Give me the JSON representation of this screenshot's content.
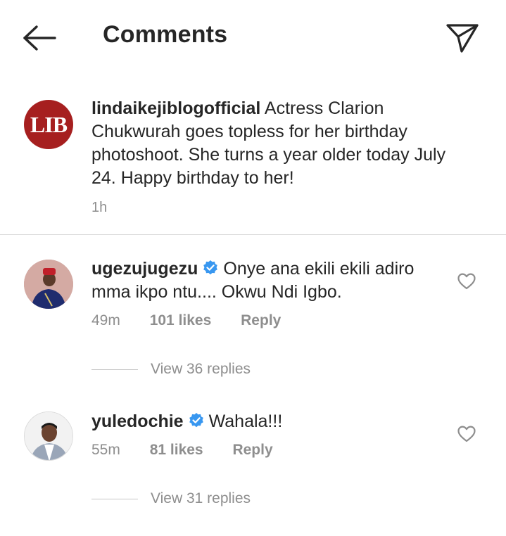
{
  "header": {
    "title": "Comments",
    "back_icon": "arrow-left-icon",
    "send_icon": "paper-plane-icon"
  },
  "caption": {
    "avatar_text": "LIB",
    "username": "lindaikejiblogofficial",
    "text": "Actress Clarion Chukwurah goes topless for her birthday photoshoot. She turns a year older today July 24. Happy birthday to her!",
    "time": "1h"
  },
  "comments": [
    {
      "username": "ugezujugezu",
      "verified": true,
      "text": "Onye ana ekili ekili adiro mma ikpo ntu.... Okwu Ndi Igbo.",
      "time": "49m",
      "likes": "101 likes",
      "reply": "Reply",
      "view_replies": "View 36 replies"
    },
    {
      "username": "yuledochie",
      "verified": true,
      "text": "Wahala!!!",
      "time": "55m",
      "likes": "81 likes",
      "reply": "Reply",
      "view_replies": "View 31 replies"
    }
  ],
  "colors": {
    "verified_blue": "#3897f0",
    "muted_text": "#8e8e8e",
    "lib_red": "#a61f1f"
  }
}
